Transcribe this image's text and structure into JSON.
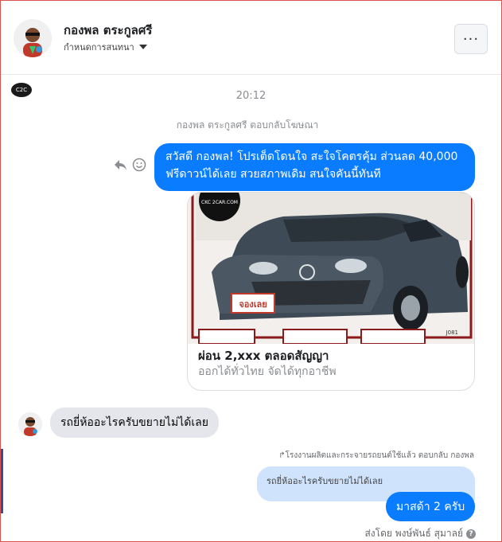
{
  "header": {
    "name": "กองพล ตระกูลศรี",
    "subtitle": "กำหนดการสนทนา",
    "more_label": "···"
  },
  "page_logo": "C2C",
  "thread": {
    "timestamp": "20:12",
    "context_note": "กองพล ตระกูลศรี ตอบกลับโฆษณา",
    "message1": "สวัสดี กองพล! โปรเต็ดโดนใจ สะใจโคตรคุ้ม ส่วนลด 40,000 ฟรีดาวน์ได้เลย สวยสภาพเดิม สนใจคันนี้ทันที",
    "ad": {
      "image_logo_text": "CKC 2CAR.COM",
      "plate_text": "จองเลย",
      "code": "J081",
      "title": "ผ่อน 2,xxx ตลอดสัญญา",
      "description": "ออกได้ทั่วไทย จัดได้ทุกอาชีพ"
    },
    "customer_message": "รถยี่ห้ออะไรครับขยายไม่ได้เลย",
    "reply_context": "โรงงานผลิตและกระจายรถยนต์ใช้แล้ว ตอบกลับ กองพล",
    "quoted_text": "รถยี่ห้ออะไรครับขยายไม่ได้เลย",
    "message2": "มาสด้า 2 ครับ",
    "sent_by": "ส่งโดย พงษ์พันธ์ สุมาลย์",
    "help_glyph": "?"
  },
  "colors": {
    "accent": "#0a7cff",
    "gray_bubble": "#e4e6eb",
    "quoted_bubble": "#cfe3fc"
  }
}
